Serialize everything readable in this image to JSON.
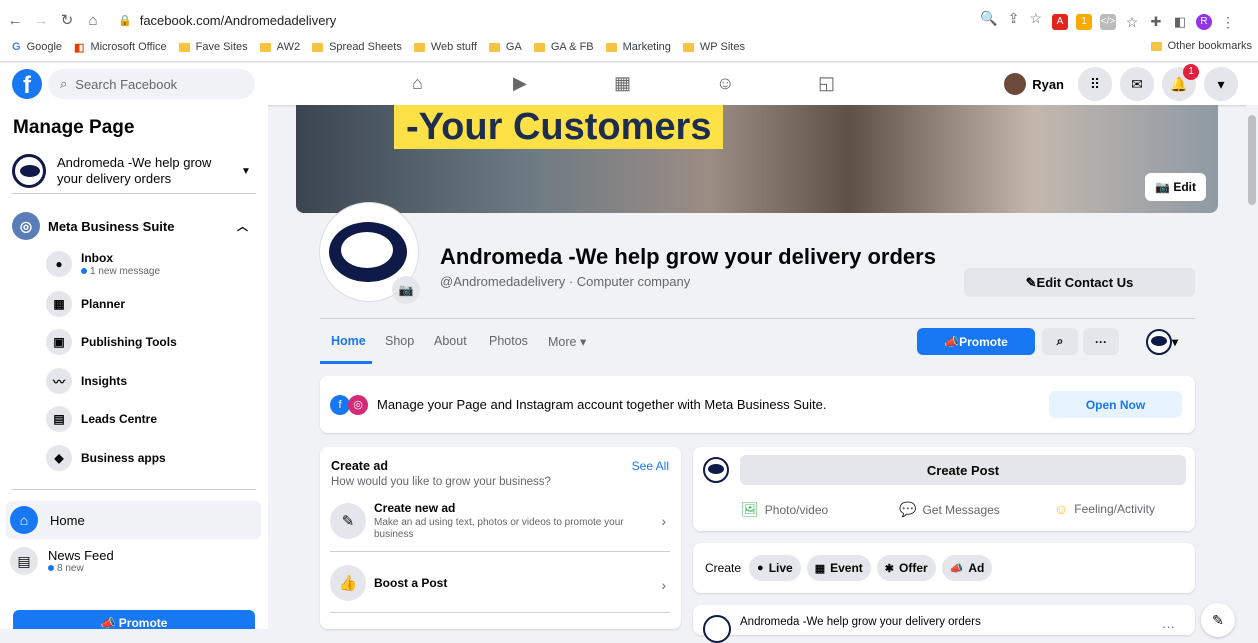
{
  "browser": {
    "url": "facebook.com/Andromedadelivery",
    "bookmarks": [
      "Google",
      "Microsoft Office",
      "Fave Sites",
      "AW2",
      "Spread Sheets",
      "Web stuff",
      "GA",
      "GA & FB",
      "Marketing",
      "WP Sites"
    ],
    "other_bookmarks": "Other bookmarks",
    "profile_initial": "R"
  },
  "fb": {
    "search_placeholder": "Search Facebook",
    "user_name": "Ryan",
    "notif_count": "1"
  },
  "sidebar": {
    "title": "Manage Page",
    "page_name": "Andromeda -We help grow your delivery orders",
    "business_suite": "Meta Business Suite",
    "items": [
      {
        "label": "Inbox",
        "sub": "1 new message"
      },
      {
        "label": "Planner"
      },
      {
        "label": "Publishing Tools"
      },
      {
        "label": "Insights"
      },
      {
        "label": "Leads Centre"
      },
      {
        "label": "Business apps"
      }
    ],
    "home": "Home",
    "news_feed": "News Feed",
    "news_feed_sub": "8 new",
    "promote": "Promote"
  },
  "cover": {
    "headline": "-Your Customers",
    "edit": "Edit"
  },
  "page": {
    "name": "Andromeda -We help grow your delivery orders",
    "subtitle": "@Andromedadelivery · Computer company",
    "edit_contact": "Edit Contact Us"
  },
  "tabs": [
    "Home",
    "Shop",
    "About",
    "Photos",
    "More"
  ],
  "actions": {
    "promote": "Promote"
  },
  "mbs_banner": {
    "message": "Manage your Page and Instagram account together with Meta Business Suite.",
    "button": "Open Now"
  },
  "create_ad": {
    "title": "Create ad",
    "subtitle": "How would you like to grow your business?",
    "see_all": "See All",
    "items": [
      {
        "title": "Create new ad",
        "desc": "Make an ad using text, photos or videos to promote your business"
      },
      {
        "title": "Boost a Post",
        "desc": ""
      }
    ]
  },
  "create_post": {
    "button": "Create Post",
    "actions": [
      "Photo/video",
      "Get Messages",
      "Feeling/Activity"
    ]
  },
  "create_row": {
    "label": "Create",
    "pills": [
      "Live",
      "Event",
      "Offer",
      "Ad"
    ]
  },
  "post": {
    "author": "Andromeda -We help grow your delivery orders"
  },
  "colors": {
    "fb_blue": "#1877f2",
    "cover_yellow": "#fde146",
    "brand_navy": "#0f1a48"
  }
}
